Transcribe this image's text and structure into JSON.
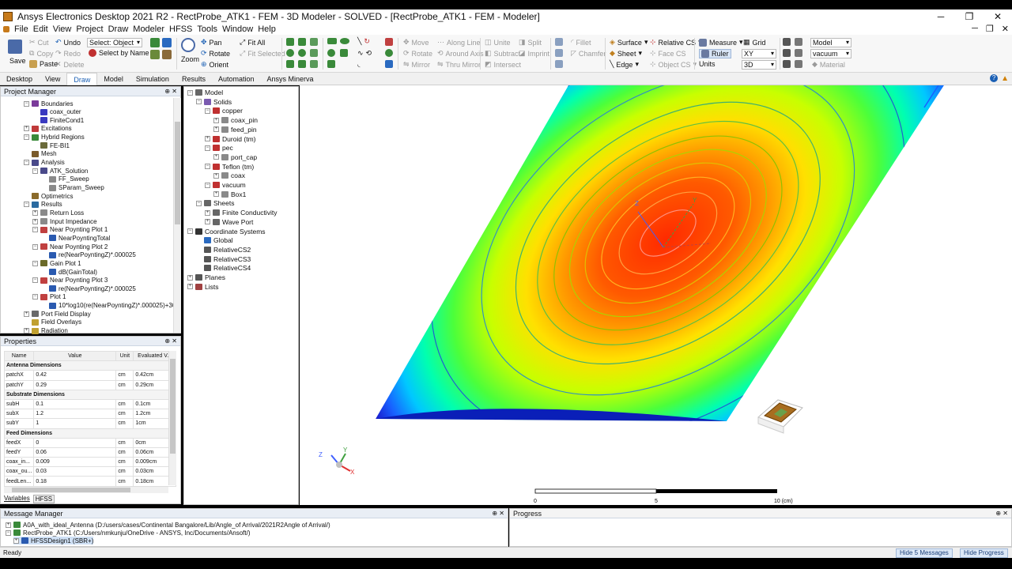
{
  "window": {
    "title": "Ansys Electronics Desktop 2021 R2 - RectProbe_ATK1 - FEM - 3D Modeler - SOLVED - [RectProbe_ATK1 - FEM - Modeler]",
    "minimize": "─",
    "maximize": "❐",
    "close": "✕"
  },
  "menu": [
    "File",
    "Edit",
    "View",
    "Project",
    "Draw",
    "Modeler",
    "HFSS",
    "Tools",
    "Window",
    "Help"
  ],
  "menu_right": [
    "─",
    "❐",
    "✕"
  ],
  "ribbon": {
    "save": "Save",
    "cut": "Cut",
    "copy": "Copy",
    "paste": "Paste",
    "undo": "Undo",
    "redo": "Redo",
    "delete": "Delete",
    "select_label": "Select: Object",
    "select_by_name": "Select by Name",
    "zoom": "Zoom",
    "pan": "Pan",
    "rotate": "Rotate",
    "orient": "Orient",
    "fit_all": "Fit All",
    "fit_selected": "Fit Selected",
    "move": "Move",
    "rotate2": "Rotate",
    "mirror": "Mirror",
    "along_line": "Along Line",
    "around_axis": "Around Axis",
    "thru_mirror": "Thru Mirror",
    "unite": "Unite",
    "subtract": "Subtract",
    "intersect": "Intersect",
    "split": "Split",
    "imprint": "Imprint",
    "fillet": "Fillet",
    "chamfer": "Chamfer",
    "surface": "Surface",
    "sheet": "Sheet",
    "edge": "Edge",
    "relative_cs": "Relative CS",
    "face_cs": "Face CS",
    "object_cs": "Object CS",
    "measure": "Measure",
    "ruler": "Ruler",
    "units": "Units",
    "grid": "Grid",
    "plane": "XY",
    "dim": "3D",
    "model": "Model",
    "material": "vacuum",
    "material_btn": "Material"
  },
  "tabs": [
    "Desktop",
    "View",
    "Draw",
    "Model",
    "Simulation",
    "Results",
    "Automation",
    "Ansys Minerva"
  ],
  "active_tab": "Draw",
  "project_manager": {
    "title": "Project Manager",
    "items": [
      {
        "label": "Boundaries",
        "indent": 1,
        "exp": "⊟",
        "color": "#7a3a9a"
      },
      {
        "label": "coax_outer",
        "indent": 2,
        "exp": "",
        "color": "#3a3ac0"
      },
      {
        "label": "FiniteCond1",
        "indent": 2,
        "exp": "",
        "color": "#3a3ac0"
      },
      {
        "label": "Excitations",
        "indent": 1,
        "exp": "⊞",
        "color": "#c03a3a"
      },
      {
        "label": "Hybrid Regions",
        "indent": 1,
        "exp": "⊟",
        "color": "#3a8a3a"
      },
      {
        "label": "FE-BI1",
        "indent": 2,
        "exp": "",
        "color": "#6a6a3a"
      },
      {
        "label": "Mesh",
        "indent": 1,
        "exp": "",
        "color": "#7a5a2a"
      },
      {
        "label": "Analysis",
        "indent": 1,
        "exp": "⊟",
        "color": "#4a4a8a"
      },
      {
        "label": "ATK_Solution",
        "indent": 2,
        "exp": "⊟",
        "color": "#4a4a8a"
      },
      {
        "label": "FF_Sweep",
        "indent": 3,
        "exp": "",
        "color": "#8a8a8a"
      },
      {
        "label": "SParam_Sweep",
        "indent": 3,
        "exp": "",
        "color": "#8a8a8a"
      },
      {
        "label": "Optimetrics",
        "indent": 1,
        "exp": "",
        "color": "#8a6a2a"
      },
      {
        "label": "Results",
        "indent": 1,
        "exp": "⊟",
        "color": "#2a6aa0"
      },
      {
        "label": "Return Loss",
        "indent": 2,
        "exp": "⊞",
        "color": "#8a8a8a"
      },
      {
        "label": "Input Impedance",
        "indent": 2,
        "exp": "⊞",
        "color": "#8a8a8a"
      },
      {
        "label": "Near Poynting Plot 1",
        "indent": 2,
        "exp": "⊟",
        "color": "#c04040"
      },
      {
        "label": "NearPoyntingTotal",
        "indent": 3,
        "exp": "",
        "color": "#2a5ab0"
      },
      {
        "label": "Near Poynting Plot 2",
        "indent": 2,
        "exp": "⊟",
        "color": "#c04040"
      },
      {
        "label": "re(NearPoyntingZ)*.000025",
        "indent": 3,
        "exp": "",
        "color": "#2a5ab0"
      },
      {
        "label": "Gain Plot 1",
        "indent": 2,
        "exp": "⊟",
        "color": "#6a6a2a"
      },
      {
        "label": "dB(GainTotal)",
        "indent": 3,
        "exp": "",
        "color": "#2a5ab0"
      },
      {
        "label": "Near Poynting Plot 3",
        "indent": 2,
        "exp": "⊟",
        "color": "#c04040"
      },
      {
        "label": "re(NearPoyntingZ)*.000025",
        "indent": 3,
        "exp": "",
        "color": "#2a5ab0"
      },
      {
        "label": "Plot 1",
        "indent": 2,
        "exp": "⊟",
        "color": "#c04040"
      },
      {
        "label": "10*log10(re(NearPoyntingZ)*.000025)+30",
        "indent": 3,
        "exp": "",
        "color": "#2a5ab0"
      },
      {
        "label": "Port Field Display",
        "indent": 1,
        "exp": "⊞",
        "color": "#6a6a6a"
      },
      {
        "label": "Field Overlays",
        "indent": 1,
        "exp": "",
        "color": "#c0a030"
      },
      {
        "label": "Radiation",
        "indent": 1,
        "exp": "⊞",
        "color": "#c0a030"
      }
    ]
  },
  "properties": {
    "title": "Properties",
    "columns": [
      "Name",
      "Value",
      "Unit",
      "Evaluated V..."
    ],
    "rows": [
      {
        "group": "Antenna Dimensions"
      },
      {
        "name": "patchX",
        "value": "0.42",
        "unit": "cm",
        "eval": "0.42cm"
      },
      {
        "name": "patchY",
        "value": "0.29",
        "unit": "cm",
        "eval": "0.29cm"
      },
      {
        "group": "Substrate Dimensions"
      },
      {
        "name": "subH",
        "value": "0.1",
        "unit": "cm",
        "eval": "0.1cm"
      },
      {
        "name": "subX",
        "value": "1.2",
        "unit": "cm",
        "eval": "1.2cm"
      },
      {
        "name": "subY",
        "value": "1",
        "unit": "cm",
        "eval": "1cm"
      },
      {
        "group": "Feed Dimensions"
      },
      {
        "name": "feedX",
        "value": "0",
        "unit": "cm",
        "eval": "0cm"
      },
      {
        "name": "feedY",
        "value": "0.06",
        "unit": "cm",
        "eval": "0.06cm"
      },
      {
        "name": "coax_in...",
        "value": "0.009",
        "unit": "cm",
        "eval": "0.009cm"
      },
      {
        "name": "coax_ou...",
        "value": "0.03",
        "unit": "cm",
        "eval": "0.03cm"
      },
      {
        "name": "feedLen...",
        "value": "0.18",
        "unit": "cm",
        "eval": "0.18cm"
      }
    ],
    "tabs": [
      "Variables",
      "HFSS"
    ]
  },
  "model_tree": {
    "items": [
      {
        "label": "Model",
        "indent": 0,
        "exp": "⊟",
        "color": "#666"
      },
      {
        "label": "Solids",
        "indent": 1,
        "exp": "⊟",
        "color": "#7a5ab0"
      },
      {
        "label": "copper",
        "indent": 2,
        "exp": "⊟",
        "color": "#c03030"
      },
      {
        "label": "coax_pin",
        "indent": 3,
        "exp": "⊞",
        "color": "#8a8a8a"
      },
      {
        "label": "feed_pin",
        "indent": 3,
        "exp": "⊞",
        "color": "#8a8a8a"
      },
      {
        "label": "Duroid (tm)",
        "indent": 2,
        "exp": "⊞",
        "color": "#c03030"
      },
      {
        "label": "pec",
        "indent": 2,
        "exp": "⊟",
        "color": "#c03030"
      },
      {
        "label": "port_cap",
        "indent": 3,
        "exp": "⊞",
        "color": "#8a8a8a"
      },
      {
        "label": "Teflon (tm)",
        "indent": 2,
        "exp": "⊟",
        "color": "#c03030"
      },
      {
        "label": "coax",
        "indent": 3,
        "exp": "⊞",
        "color": "#8a8a8a"
      },
      {
        "label": "vacuum",
        "indent": 2,
        "exp": "⊟",
        "color": "#c03030"
      },
      {
        "label": "Box1",
        "indent": 3,
        "exp": "⊞",
        "color": "#8a8a8a"
      },
      {
        "label": "Sheets",
        "indent": 1,
        "exp": "⊟",
        "color": "#666"
      },
      {
        "label": "Finite Conductivity",
        "indent": 2,
        "exp": "⊞",
        "color": "#666"
      },
      {
        "label": "Wave Port",
        "indent": 2,
        "exp": "⊞",
        "color": "#666"
      },
      {
        "label": "Coordinate Systems",
        "indent": 0,
        "exp": "⊟",
        "color": "#333"
      },
      {
        "label": "Global",
        "indent": 1,
        "exp": "",
        "color": "#2a6ac0"
      },
      {
        "label": "RelativeCS2",
        "indent": 1,
        "exp": "",
        "color": "#555"
      },
      {
        "label": "RelativeCS3",
        "indent": 1,
        "exp": "",
        "color": "#555"
      },
      {
        "label": "RelativeCS4",
        "indent": 1,
        "exp": "",
        "color": "#555"
      },
      {
        "label": "Planes",
        "indent": 0,
        "exp": "⊞",
        "color": "#555"
      },
      {
        "label": "Lists",
        "indent": 0,
        "exp": "⊞",
        "color": "#a04040"
      }
    ]
  },
  "viewport": {
    "scale_labels": [
      "0",
      "5",
      "10 (cm)"
    ],
    "axis_labels": [
      "Z",
      "Y",
      "X"
    ]
  },
  "message_manager": {
    "title": "Message Manager",
    "lines": [
      "A0A_with_ideal_Antenna (D:/users/cases/Continental Bangalore/Lib/Angle_of Arrival/2021R2Angle of Arrival/)",
      "RectProbe_ATK1 (C:/Users/nmkunju/OneDrive - ANSYS, Inc/Documents/Ansoft/)",
      "HFSSDesign1 (SBR+)"
    ]
  },
  "progress": {
    "title": "Progress"
  },
  "status": {
    "text": "Ready",
    "hide_messages": "Hide 5 Messages",
    "hide_progress": "Hide Progress"
  }
}
